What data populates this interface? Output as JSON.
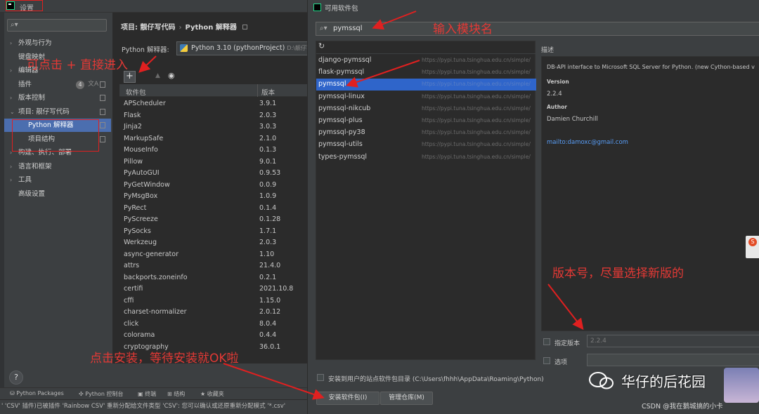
{
  "settings_window": {
    "title": "设置",
    "search_placeholder": "",
    "tree": [
      {
        "label": "外观与行为",
        "arrow": "›"
      },
      {
        "label": "键盘映射",
        "arrow": ""
      },
      {
        "label": "编辑器",
        "arrow": "›"
      },
      {
        "label": "插件",
        "arrow": "",
        "badge": "4"
      },
      {
        "label": "版本控制",
        "arrow": "›"
      },
      {
        "label": "项目: 靓仔写代码",
        "arrow": "⌄"
      },
      {
        "label": "Python 解释器",
        "arrow": "",
        "selected": true
      },
      {
        "label": "项目结构",
        "arrow": ""
      },
      {
        "label": "构建、执行、部署",
        "arrow": "›"
      },
      {
        "label": "语言和框架",
        "arrow": "›"
      },
      {
        "label": "工具",
        "arrow": "›"
      },
      {
        "label": "高级设置",
        "arrow": ""
      }
    ],
    "breadcrumb": {
      "project": "项目: 靓仔写代码",
      "separator": "›",
      "page": "Python 解释器"
    },
    "interpreter": {
      "label": "Python 解释器:",
      "value": "Python 3.10 (pythonProject)",
      "path": "D:\\靓仔写"
    },
    "table": {
      "col_package": "软件包",
      "col_version": "版本",
      "rows": [
        [
          "APScheduler",
          "3.9.1"
        ],
        [
          "Flask",
          "2.0.3"
        ],
        [
          "Jinja2",
          "3.0.3"
        ],
        [
          "MarkupSafe",
          "2.1.0"
        ],
        [
          "MouseInfo",
          "0.1.3"
        ],
        [
          "Pillow",
          "9.0.1"
        ],
        [
          "PyAutoGUI",
          "0.9.53"
        ],
        [
          "PyGetWindow",
          "0.0.9"
        ],
        [
          "PyMsgBox",
          "1.0.9"
        ],
        [
          "PyRect",
          "0.1.4"
        ],
        [
          "PyScreeze",
          "0.1.28"
        ],
        [
          "PySocks",
          "1.7.1"
        ],
        [
          "Werkzeug",
          "2.0.3"
        ],
        [
          "async-generator",
          "1.10"
        ],
        [
          "attrs",
          "21.4.0"
        ],
        [
          "backports.zoneinfo",
          "0.2.1"
        ],
        [
          "certifi",
          "2021.10.8"
        ],
        [
          "cffi",
          "1.15.0"
        ],
        [
          "charset-normalizer",
          "2.0.12"
        ],
        [
          "click",
          "8.0.4"
        ],
        [
          "colorama",
          "0.4.4"
        ],
        [
          "cryptography",
          "36.0.1"
        ]
      ]
    },
    "tool_strip": [
      "Python Packages",
      "Python 控制台",
      "终端",
      "结构",
      "收藏夹"
    ],
    "status_text": "' 'CSV' 插件)已被插件 'Rainbow CSV' 重新分配给文件类型 'CSV': 您可以确认或还原重新分配模式 '*.csv'"
  },
  "available_window": {
    "title": "可用软件包",
    "search_value": "pymssql",
    "packages": [
      {
        "name": "django-pymssql",
        "url": "https://pypi.tuna.tsinghua.edu.cn/simple/"
      },
      {
        "name": "flask-pymssql",
        "url": "https://pypi.tuna.tsinghua.edu.cn/simple/"
      },
      {
        "name": "pymssql",
        "url": "https://pypi.tuna.tsinghua.edu.cn/simple/",
        "selected": true
      },
      {
        "name": "pymssql-linux",
        "url": "https://pypi.tuna.tsinghua.edu.cn/simple/"
      },
      {
        "name": "pymssql-nikcub",
        "url": "https://pypi.tuna.tsinghua.edu.cn/simple/"
      },
      {
        "name": "pymssql-plus",
        "url": "https://pypi.tuna.tsinghua.edu.cn/simple/"
      },
      {
        "name": "pymssql-py38",
        "url": "https://pypi.tuna.tsinghua.edu.cn/simple/"
      },
      {
        "name": "pymssql-utils",
        "url": "https://pypi.tuna.tsinghua.edu.cn/simple/"
      },
      {
        "name": "types-pymssql",
        "url": "https://pypi.tuna.tsinghua.edu.cn/simple/"
      }
    ],
    "description": {
      "label": "描述",
      "summary": "DB-API interface to Microsoft SQL Server for Python. (new Cython-based v",
      "version_key": "Version",
      "version_value": "2.2.4",
      "author_key": "Author",
      "author_value": "Damien Churchill",
      "email": "mailto:damoxc@gmail.com"
    },
    "specify_version": {
      "label": "指定版本",
      "value": "2.2.4"
    },
    "options": {
      "label": "选项"
    },
    "user_site": "安装到用户的站点软件包目录 (C:\\Users\\fhhh\\AppData\\Roaming\\Python)",
    "install_button": "安装软件包(I)",
    "manage_button": "管理仓库(M)"
  },
  "annotations": {
    "click_plus": "可点击 + 直接进入",
    "enter_module": "输入模块名",
    "version_hint": "版本号，尽量选择新版的",
    "install_hint": "点击安装，等待安装就OK啦"
  },
  "watermark": {
    "name": "华仔的后花园",
    "csdn": "CSDN @我在鹅城搞的小卡"
  },
  "colors": {
    "annotation": "#e02020",
    "selection": "#2f65ca",
    "tree_selection": "#4b6eaf"
  }
}
